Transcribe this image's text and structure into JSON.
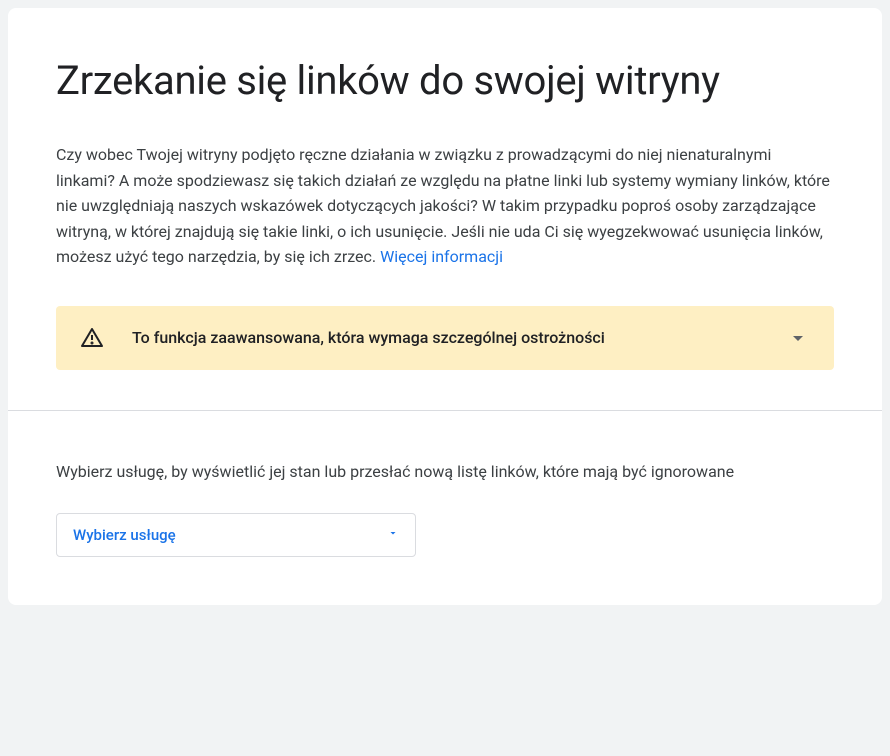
{
  "title": "Zrzekanie się linków do swojej witryny",
  "description": "Czy wobec Twojej witryny podjęto ręczne działania w związku z prowadzącymi do niej nienaturalnymi linkami? A może spodziewasz się takich działań ze względu na płatne linki lub systemy wymiany linków, które nie uwzględniają naszych wskazówek dotyczących jakości? W takim przypadku poproś osoby zarządzające witryną, w której znajdują się takie linki, o ich usunięcie. Jeśli nie uda Ci się wyegzekwować usunięcia linków, możesz użyć tego narzędzia, by się ich zrzec. ",
  "moreInfoLabel": "Więcej informacji",
  "warning": {
    "text": "To funkcja zaawansowana, która wymaga szczególnej ostrożności"
  },
  "selectSection": {
    "label": "Wybierz usługę, by wyświetlić jej stan lub przesłać nową listę linków, które mają być ignorowane",
    "buttonLabel": "Wybierz usługę"
  }
}
